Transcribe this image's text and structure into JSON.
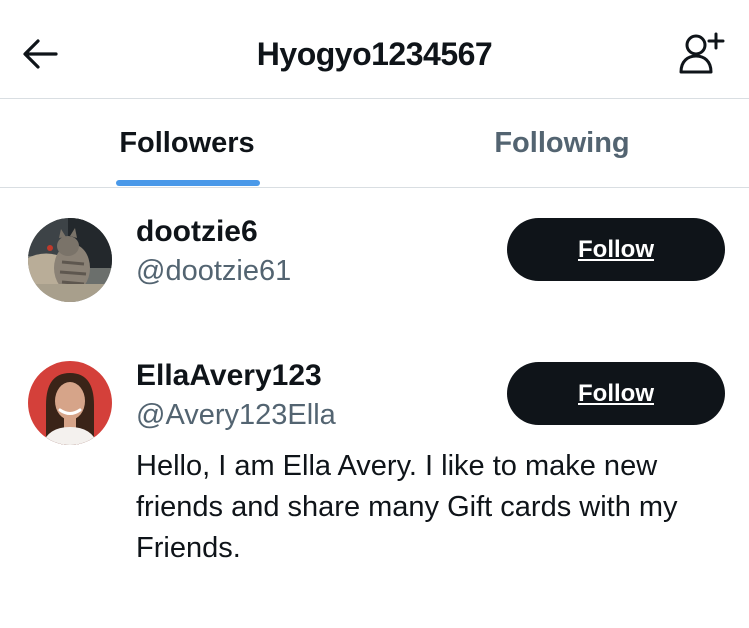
{
  "header": {
    "title": "Hyogyo1234567",
    "back_icon": "arrow-left-icon",
    "add_user_icon": "add-user-icon"
  },
  "tabs": [
    {
      "label": "Followers",
      "active": true
    },
    {
      "label": "Following",
      "active": false
    }
  ],
  "accent_color": "#4a99e9",
  "users": [
    {
      "display_name": "dootzie6",
      "handle": "@dootzie61",
      "follow_label": "Follow",
      "bio": ""
    },
    {
      "display_name": "EllaAvery123",
      "handle": "@Avery123Ella",
      "follow_label": "Follow",
      "bio": "Hello, I am Ella Avery. I like to make new friends and share many Gift cards with my Friends."
    }
  ]
}
